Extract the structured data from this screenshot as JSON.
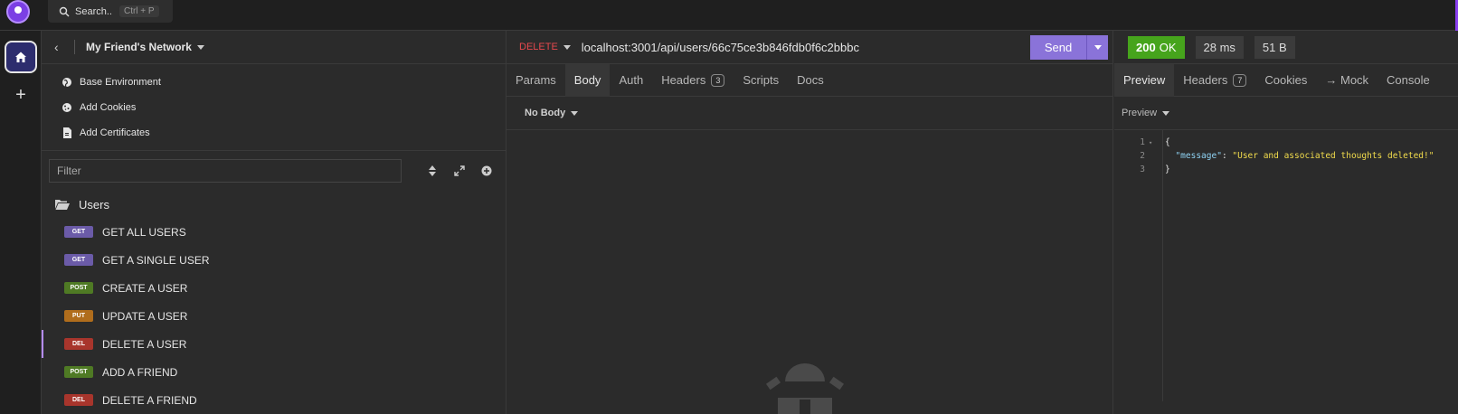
{
  "topbar": {
    "search_label": "Search..",
    "search_shortcut": "Ctrl + P"
  },
  "rail": {
    "home_label": "home",
    "add_label": "+"
  },
  "sidebar": {
    "back_glyph": "‹",
    "workspace_title": "My Friend's Network",
    "links": [
      {
        "label": "Base Environment",
        "icon": "globe-icon"
      },
      {
        "label": "Add Cookies",
        "icon": "cookie-icon"
      },
      {
        "label": "Add Certificates",
        "icon": "certificate-icon"
      }
    ],
    "filter_placeholder": "Filter",
    "folder_name": "Users",
    "requests": [
      {
        "method": "GET",
        "label": "GET ALL USERS",
        "color": "#6b5ba8"
      },
      {
        "method": "GET",
        "label": "GET A SINGLE USER",
        "color": "#6b5ba8"
      },
      {
        "method": "POST",
        "label": "CREATE A USER",
        "color": "#4f7a24"
      },
      {
        "method": "PUT",
        "label": "UPDATE A USER",
        "color": "#b06d1c"
      },
      {
        "method": "DEL",
        "label": "DELETE A USER",
        "color": "#a8352c"
      },
      {
        "method": "POST",
        "label": "ADD A FRIEND",
        "color": "#4f7a24"
      },
      {
        "method": "DEL",
        "label": "DELETE A FRIEND",
        "color": "#a8352c"
      }
    ]
  },
  "request": {
    "method": "DELETE",
    "url": "localhost:3001/api/users/66c75ce3b846fdb0f6c2bbbc",
    "send_label": "Send",
    "tabs": [
      "Params",
      "Body",
      "Auth",
      "Headers",
      "Scripts",
      "Docs"
    ],
    "headers_count": "3",
    "body_mode": "No Body"
  },
  "response": {
    "status_code": "200",
    "status_text": "OK",
    "time": "28 ms",
    "size": "51 B",
    "tabs": [
      "Preview",
      "Headers",
      "Cookies",
      "→ Mock",
      "Console"
    ],
    "headers_count": "7",
    "preview_mode": "Preview",
    "code": {
      "line1": "{",
      "key": "\"message\"",
      "sep": ": ",
      "value": "\"User and associated thoughts deleted!\"",
      "line3": "}",
      "n1": "1",
      "n2": "2",
      "n3": "3"
    }
  },
  "colors": {
    "accent": "#8a73d9",
    "status_ok": "#46a41c",
    "delete_red": "#e5484d"
  }
}
